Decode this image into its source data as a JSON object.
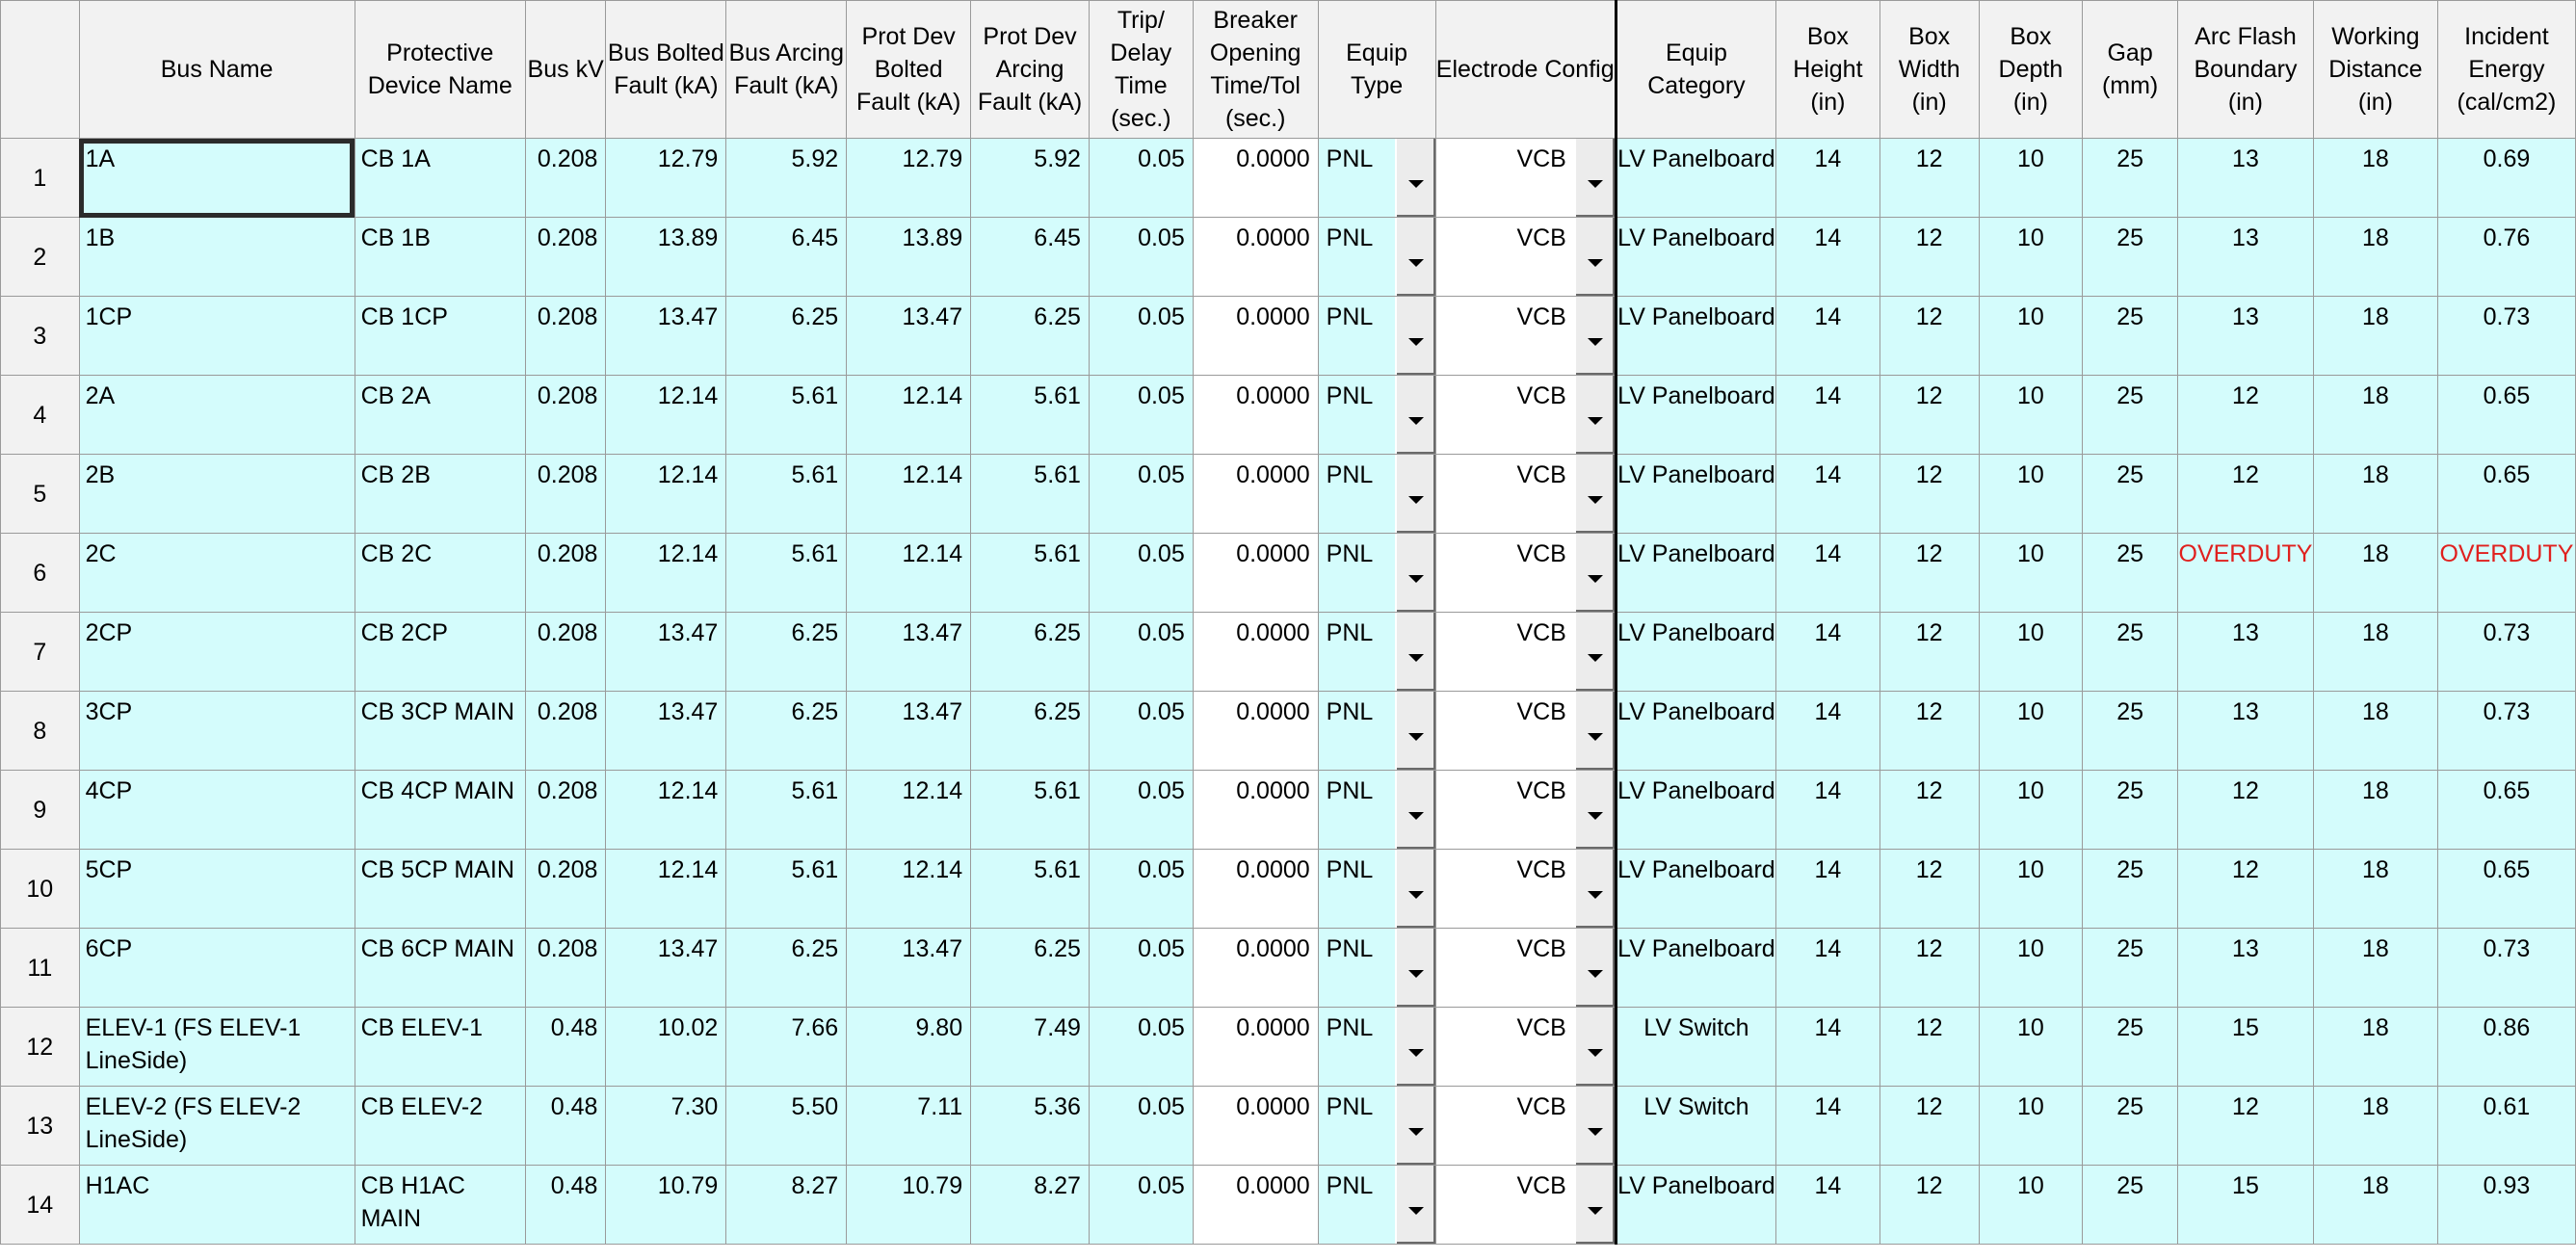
{
  "columns": [
    "",
    "Bus Name",
    "Protective Device Name",
    "Bus kV",
    "Bus Bolted Fault (kA)",
    "Bus Arcing Fault (kA)",
    "Prot Dev Bolted Fault (kA)",
    "Prot Dev Arcing Fault (kA)",
    "Trip/ Delay Time (sec.)",
    "Breaker Opening Time/Tol (sec.)",
    "Equip Type",
    "Electrode Config",
    "Equip Category",
    "Box Height (in)",
    "Box Width (in)",
    "Box Depth (in)",
    "Gap (mm)",
    "Arc Flash Boundary (in)",
    "Working Distance (in)",
    "Incident Energy (cal/cm2)"
  ],
  "rows": [
    {
      "num": "1",
      "bus": "1A",
      "device": "CB 1A",
      "kv": "0.208",
      "bbf": "12.79",
      "baf": "5.92",
      "pdbf": "12.79",
      "pdaf": "5.92",
      "trip": "0.05",
      "bot": "0.0000",
      "equip": "PNL",
      "electrode": "VCB",
      "category": "LV Panelboard",
      "bh": "14",
      "bw": "12",
      "bd": "10",
      "gap": "25",
      "afb": "13",
      "wd": "18",
      "ie": "0.69"
    },
    {
      "num": "2",
      "bus": "1B",
      "device": "CB 1B",
      "kv": "0.208",
      "bbf": "13.89",
      "baf": "6.45",
      "pdbf": "13.89",
      "pdaf": "6.45",
      "trip": "0.05",
      "bot": "0.0000",
      "equip": "PNL",
      "electrode": "VCB",
      "category": "LV Panelboard",
      "bh": "14",
      "bw": "12",
      "bd": "10",
      "gap": "25",
      "afb": "13",
      "wd": "18",
      "ie": "0.76"
    },
    {
      "num": "3",
      "bus": "1CP",
      "device": "CB 1CP",
      "kv": "0.208",
      "bbf": "13.47",
      "baf": "6.25",
      "pdbf": "13.47",
      "pdaf": "6.25",
      "trip": "0.05",
      "bot": "0.0000",
      "equip": "PNL",
      "electrode": "VCB",
      "category": "LV Panelboard",
      "bh": "14",
      "bw": "12",
      "bd": "10",
      "gap": "25",
      "afb": "13",
      "wd": "18",
      "ie": "0.73"
    },
    {
      "num": "4",
      "bus": "2A",
      "device": "CB 2A",
      "kv": "0.208",
      "bbf": "12.14",
      "baf": "5.61",
      "pdbf": "12.14",
      "pdaf": "5.61",
      "trip": "0.05",
      "bot": "0.0000",
      "equip": "PNL",
      "electrode": "VCB",
      "category": "LV Panelboard",
      "bh": "14",
      "bw": "12",
      "bd": "10",
      "gap": "25",
      "afb": "12",
      "wd": "18",
      "ie": "0.65"
    },
    {
      "num": "5",
      "bus": "2B",
      "device": "CB 2B",
      "kv": "0.208",
      "bbf": "12.14",
      "baf": "5.61",
      "pdbf": "12.14",
      "pdaf": "5.61",
      "trip": "0.05",
      "bot": "0.0000",
      "equip": "PNL",
      "electrode": "VCB",
      "category": "LV Panelboard",
      "bh": "14",
      "bw": "12",
      "bd": "10",
      "gap": "25",
      "afb": "12",
      "wd": "18",
      "ie": "0.65"
    },
    {
      "num": "6",
      "bus": "2C",
      "device": "CB 2C",
      "kv": "0.208",
      "bbf": "12.14",
      "baf": "5.61",
      "pdbf": "12.14",
      "pdaf": "5.61",
      "trip": "0.05",
      "bot": "0.0000",
      "equip": "PNL",
      "electrode": "VCB",
      "category": "LV Panelboard",
      "bh": "14",
      "bw": "12",
      "bd": "10",
      "gap": "25",
      "afb": "OVERDUTY",
      "wd": "18",
      "ie": "OVERDUTY"
    },
    {
      "num": "7",
      "bus": "2CP",
      "device": "CB 2CP",
      "kv": "0.208",
      "bbf": "13.47",
      "baf": "6.25",
      "pdbf": "13.47",
      "pdaf": "6.25",
      "trip": "0.05",
      "bot": "0.0000",
      "equip": "PNL",
      "electrode": "VCB",
      "category": "LV Panelboard",
      "bh": "14",
      "bw": "12",
      "bd": "10",
      "gap": "25",
      "afb": "13",
      "wd": "18",
      "ie": "0.73"
    },
    {
      "num": "8",
      "bus": "3CP",
      "device": "CB 3CP MAIN",
      "kv": "0.208",
      "bbf": "13.47",
      "baf": "6.25",
      "pdbf": "13.47",
      "pdaf": "6.25",
      "trip": "0.05",
      "bot": "0.0000",
      "equip": "PNL",
      "electrode": "VCB",
      "category": "LV Panelboard",
      "bh": "14",
      "bw": "12",
      "bd": "10",
      "gap": "25",
      "afb": "13",
      "wd": "18",
      "ie": "0.73"
    },
    {
      "num": "9",
      "bus": "4CP",
      "device": "CB 4CP MAIN",
      "kv": "0.208",
      "bbf": "12.14",
      "baf": "5.61",
      "pdbf": "12.14",
      "pdaf": "5.61",
      "trip": "0.05",
      "bot": "0.0000",
      "equip": "PNL",
      "electrode": "VCB",
      "category": "LV Panelboard",
      "bh": "14",
      "bw": "12",
      "bd": "10",
      "gap": "25",
      "afb": "12",
      "wd": "18",
      "ie": "0.65"
    },
    {
      "num": "10",
      "bus": "5CP",
      "device": "CB 5CP MAIN",
      "kv": "0.208",
      "bbf": "12.14",
      "baf": "5.61",
      "pdbf": "12.14",
      "pdaf": "5.61",
      "trip": "0.05",
      "bot": "0.0000",
      "equip": "PNL",
      "electrode": "VCB",
      "category": "LV Panelboard",
      "bh": "14",
      "bw": "12",
      "bd": "10",
      "gap": "25",
      "afb": "12",
      "wd": "18",
      "ie": "0.65"
    },
    {
      "num": "11",
      "bus": "6CP",
      "device": "CB 6CP MAIN",
      "kv": "0.208",
      "bbf": "13.47",
      "baf": "6.25",
      "pdbf": "13.47",
      "pdaf": "6.25",
      "trip": "0.05",
      "bot": "0.0000",
      "equip": "PNL",
      "electrode": "VCB",
      "category": "LV Panelboard",
      "bh": "14",
      "bw": "12",
      "bd": "10",
      "gap": "25",
      "afb": "13",
      "wd": "18",
      "ie": "0.73"
    },
    {
      "num": "12",
      "bus": "ELEV-1 (FS ELEV-1 LineSide)",
      "device": "CB ELEV-1",
      "kv": "0.48",
      "bbf": "10.02",
      "baf": "7.66",
      "pdbf": "9.80",
      "pdaf": "7.49",
      "trip": "0.05",
      "bot": "0.0000",
      "equip": "PNL",
      "electrode": "VCB",
      "category": "LV Switch",
      "bh": "14",
      "bw": "12",
      "bd": "10",
      "gap": "25",
      "afb": "15",
      "wd": "18",
      "ie": "0.86"
    },
    {
      "num": "13",
      "bus": "ELEV-2 (FS ELEV-2 LineSide)",
      "device": "CB ELEV-2",
      "kv": "0.48",
      "bbf": "7.30",
      "baf": "5.50",
      "pdbf": "7.11",
      "pdaf": "5.36",
      "trip": "0.05",
      "bot": "0.0000",
      "equip": "PNL",
      "electrode": "VCB",
      "category": "LV Switch",
      "bh": "14",
      "bw": "12",
      "bd": "10",
      "gap": "25",
      "afb": "12",
      "wd": "18",
      "ie": "0.61"
    },
    {
      "num": "14",
      "bus": "H1AC",
      "device": "CB H1AC MAIN",
      "kv": "0.48",
      "bbf": "10.79",
      "baf": "8.27",
      "pdbf": "10.79",
      "pdaf": "8.27",
      "trip": "0.05",
      "bot": "0.0000",
      "equip": "PNL",
      "electrode": "VCB",
      "category": "LV Panelboard",
      "bh": "14",
      "bw": "12",
      "bd": "10",
      "gap": "25",
      "afb": "15",
      "wd": "18",
      "ie": "0.93"
    }
  ],
  "selected_row": 0,
  "selected_column": "bus",
  "colors": {
    "cell_background": "#d4fcfc",
    "header_background": "#f2f2f2",
    "editable_background": "#ffffff",
    "overduty_text": "#e0201e"
  },
  "icons": {
    "dropdown": "chevron-down-icon"
  }
}
